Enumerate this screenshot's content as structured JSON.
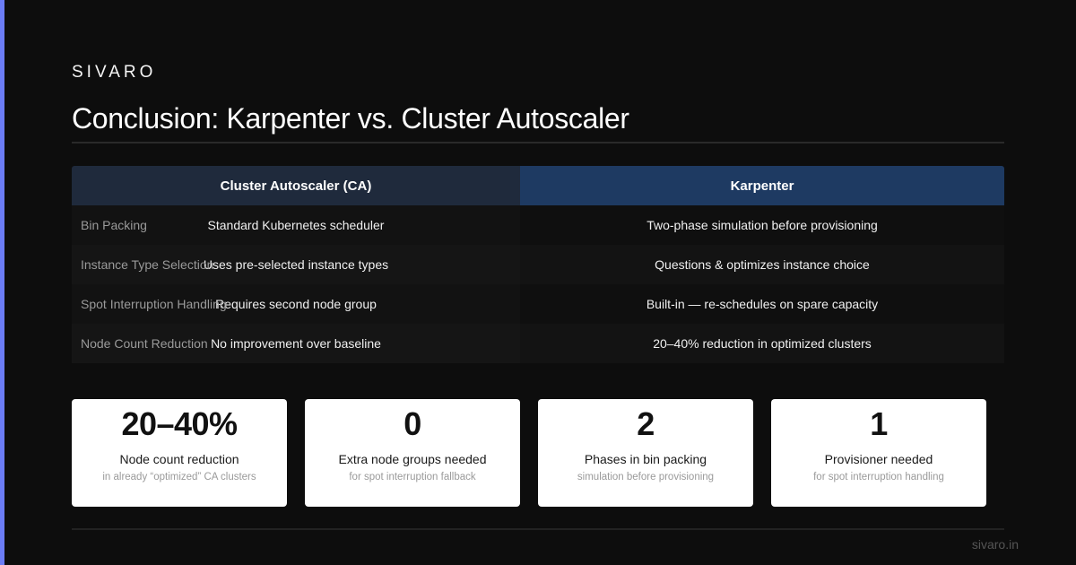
{
  "brand": "SIVARO",
  "title": "Conclusion: Karpenter vs. Cluster Autoscaler",
  "table": {
    "headers": {
      "ca": "Cluster Autoscaler (CA)",
      "karpenter": "Karpenter"
    },
    "rows": [
      {
        "label": "Bin Packing",
        "ca": "Standard Kubernetes scheduler",
        "karpenter": "Two-phase simulation before provisioning"
      },
      {
        "label": "Instance Type Selection",
        "ca": "Uses pre-selected instance types",
        "karpenter": "Questions & optimizes instance choice"
      },
      {
        "label": "Spot Interruption Handling",
        "ca": "Requires second node group",
        "karpenter": "Built-in — re-schedules on spare capacity"
      },
      {
        "label": "Node Count Reduction",
        "ca": "No improvement over baseline",
        "karpenter": "20–40% reduction in optimized clusters"
      }
    ]
  },
  "stats": [
    {
      "value": "20–40%",
      "label": "Node count reduction",
      "sub": "in already “optimized” CA clusters"
    },
    {
      "value": "0",
      "label": "Extra node groups needed",
      "sub": "for spot interruption fallback"
    },
    {
      "value": "2",
      "label": "Phases in bin packing",
      "sub": "simulation before provisioning"
    },
    {
      "value": "1",
      "label": "Provisioner needed",
      "sub": "for spot interruption handling"
    }
  ],
  "footer": {
    "url": "sivaro.in"
  },
  "colors": {
    "background": "#0d0d0d",
    "accent": "#6b7cf5",
    "ca_header": "#1f2a3c",
    "karpenter_header": "#1e3a62",
    "card": "#ffffff"
  }
}
